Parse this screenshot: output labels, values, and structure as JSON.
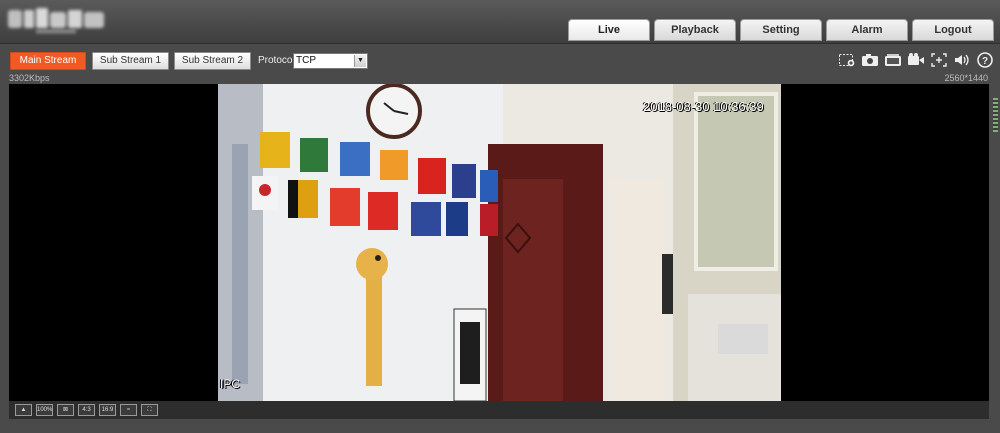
{
  "nav": {
    "tabs": [
      {
        "label": "Live",
        "active": true
      },
      {
        "label": "Playback",
        "active": false
      },
      {
        "label": "Setting",
        "active": false
      },
      {
        "label": "Alarm",
        "active": false
      },
      {
        "label": "Logout",
        "active": false
      }
    ]
  },
  "streams": {
    "main_label": "Main Stream",
    "sub1_label": "Sub Stream 1",
    "sub2_label": "Sub Stream 2",
    "active": "Main Stream"
  },
  "protocol": {
    "label": "Protocol",
    "value": "TCP"
  },
  "toolbar_icons": [
    "region-zoom-icon",
    "snapshot-icon",
    "triple-snapshot-icon",
    "record-icon",
    "digital-zoom-icon",
    "audio-icon",
    "help-icon"
  ],
  "stream_info": {
    "bitrate": "3302Kbps",
    "resolution": "2560*1440"
  },
  "video": {
    "timestamp": "2018-08-30 10:36:39",
    "channel_name": "IPC"
  },
  "bottom_controls": [
    {
      "icon": "original-size-icon",
      "label": ""
    },
    {
      "icon": "scale-100-icon",
      "label": "100%"
    },
    {
      "icon": "fit-window-icon",
      "label": ""
    },
    {
      "icon": "ratio-4-3-icon",
      "label": "4:3"
    },
    {
      "icon": "ratio-16-9-icon",
      "label": "16:9"
    },
    {
      "icon": "fluency-icon",
      "label": ""
    },
    {
      "icon": "fullscreen-icon",
      "label": ""
    }
  ],
  "colors": {
    "accent": "#f15a22",
    "background": "#4a4a4a"
  }
}
